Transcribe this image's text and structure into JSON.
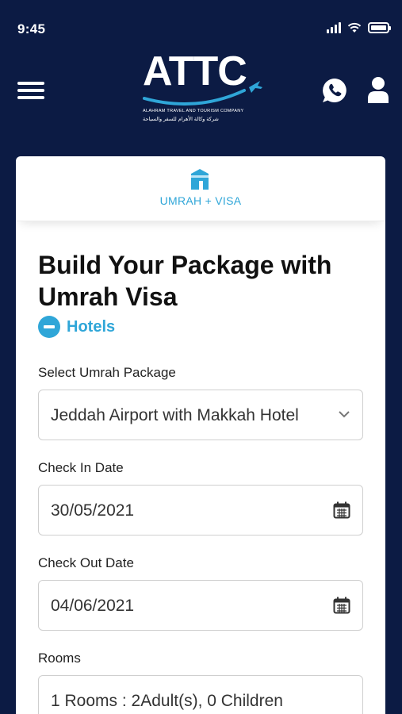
{
  "status_bar": {
    "time": "9:45"
  },
  "header": {
    "logo_text": "ATTC",
    "logo_subtitle": "ALAHRAM TRAVEL AND TOURISM COMPANY",
    "logo_subtitle_ar": "شركة وكالة الأهرام للسفر والسياحة"
  },
  "tab": {
    "label": "UMRAH + VISA"
  },
  "form": {
    "title": "Build Your Package with Umrah Visa",
    "section_label": "Hotels",
    "package_label": "Select Umrah Package",
    "package_value": "Jeddah Airport with Makkah Hotel",
    "checkin_label": "Check In Date",
    "checkin_value": "30/05/2021",
    "checkout_label": "Check Out Date",
    "checkout_value": "04/06/2021",
    "rooms_label": "Rooms",
    "rooms_value": "1 Rooms : 2Adult(s), 0 Children"
  },
  "colors": {
    "background": "#0c1b44",
    "accent": "#2fa6d8",
    "card": "#ffffff"
  },
  "icons": [
    "menu-icon",
    "whatsapp-icon",
    "user-icon",
    "kaaba-icon",
    "minus-icon",
    "chevron-down-icon",
    "calendar-icon"
  ]
}
